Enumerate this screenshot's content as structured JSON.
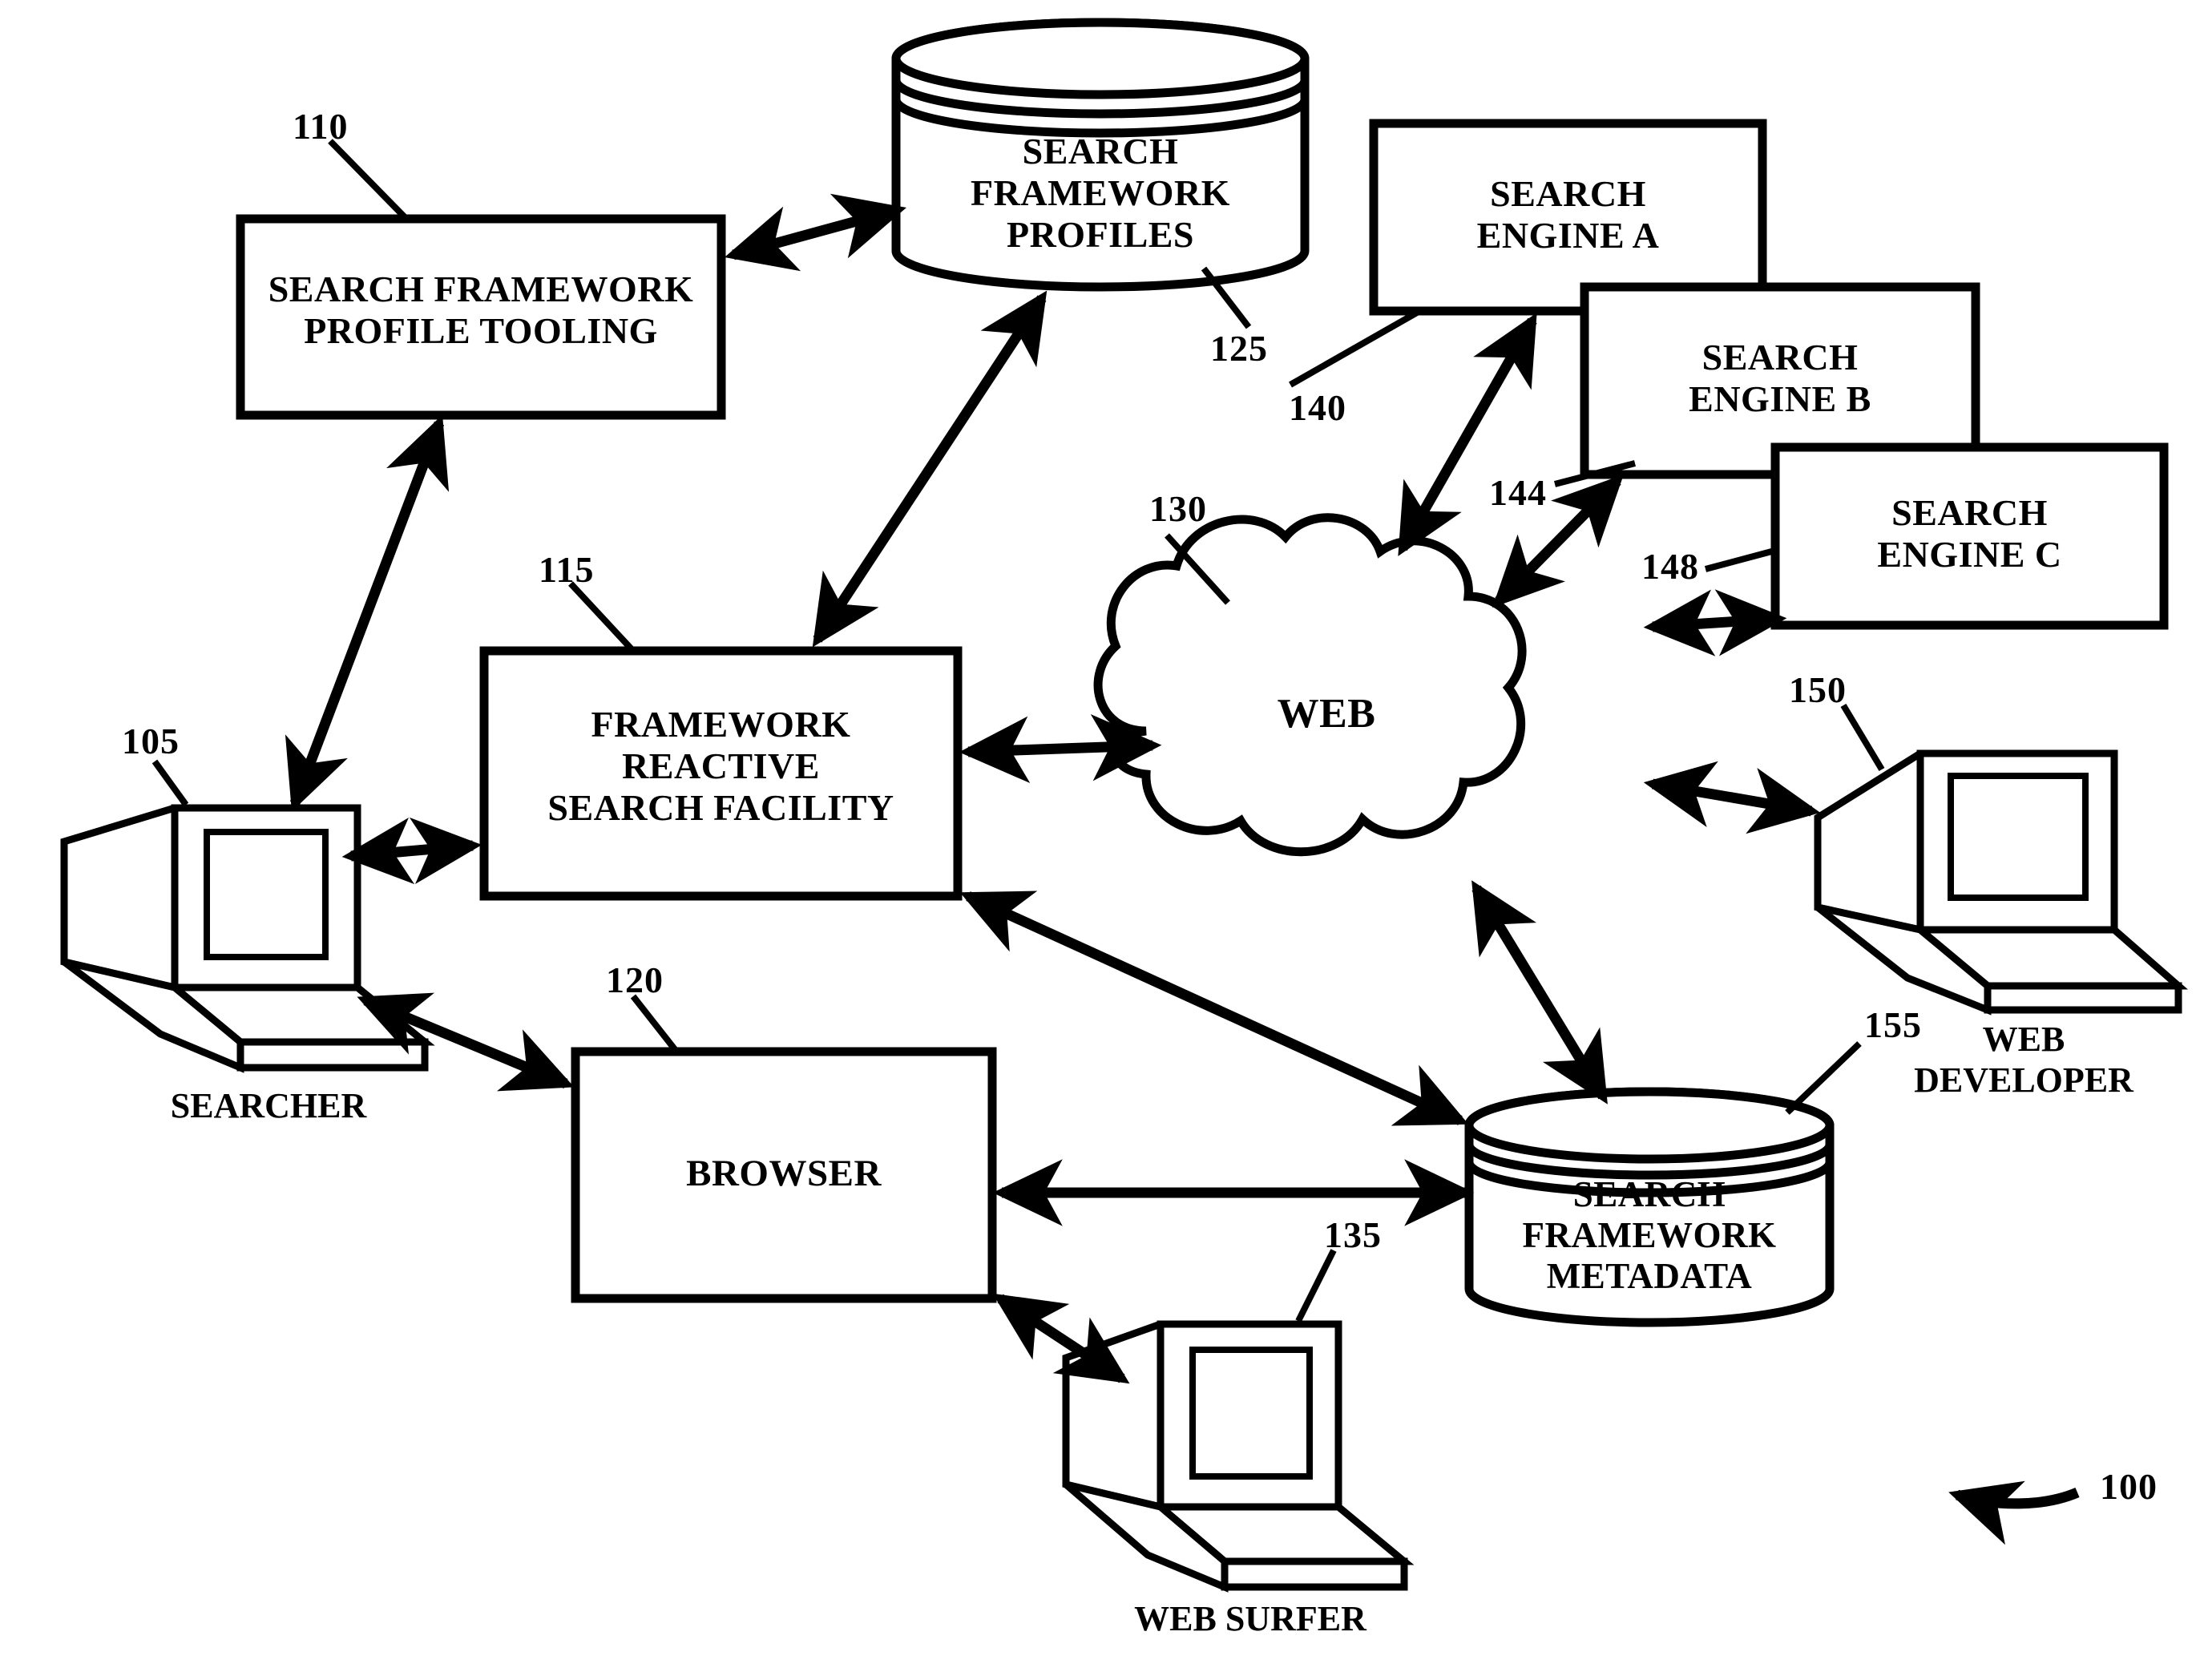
{
  "figure": {
    "reference_numeral": "100",
    "style": {
      "stroke": "#000000",
      "fill": "#ffffff",
      "background": "#ffffff"
    }
  },
  "nodes": {
    "profile_tooling": {
      "label": "SEARCH FRAMEWORK\nPROFILE TOOLING",
      "ref": "110",
      "shape": "rectangle"
    },
    "profiles_store": {
      "label": "SEARCH\nFRAMEWORK\nPROFILES",
      "ref": "125",
      "shape": "cylinder"
    },
    "search_engine_a": {
      "label": "SEARCH\nENGINE A",
      "ref": "140",
      "shape": "rectangle"
    },
    "search_engine_b": {
      "label": "SEARCH\nENGINE B",
      "ref": "144",
      "shape": "rectangle"
    },
    "search_engine_c": {
      "label": "SEARCH\nENGINE C",
      "ref": "148",
      "shape": "rectangle"
    },
    "web_cloud": {
      "label": "WEB",
      "ref": "130",
      "shape": "cloud"
    },
    "search_facility": {
      "label": "FRAMEWORK\nREACTIVE\nSEARCH FACILITY",
      "ref": "115",
      "shape": "rectangle"
    },
    "browser": {
      "label": "BROWSER",
      "ref": "120",
      "shape": "rectangle"
    },
    "metadata_store": {
      "label": "SEARCH\nFRAMEWORK\nMETADATA",
      "ref": "155",
      "shape": "cylinder"
    },
    "searcher_computer": {
      "label": "SEARCHER",
      "ref": "105",
      "shape": "computer"
    },
    "web_surfer_computer": {
      "label": "WEB SURFER",
      "ref": "135",
      "shape": "computer"
    },
    "web_developer_computer": {
      "label": "WEB\nDEVELOPER",
      "ref": "150",
      "shape": "computer"
    }
  },
  "connections": [
    {
      "from": "profile_tooling",
      "to": "profiles_store",
      "arrow": "both"
    },
    {
      "from": "profiles_store",
      "to": "search_facility",
      "arrow": "both"
    },
    {
      "from": "searcher_computer",
      "to": "profile_tooling",
      "arrow": "both"
    },
    {
      "from": "searcher_computer",
      "to": "search_facility",
      "arrow": "both"
    },
    {
      "from": "searcher_computer",
      "to": "browser",
      "arrow": "both"
    },
    {
      "from": "search_facility",
      "to": "web_cloud",
      "arrow": "both"
    },
    {
      "from": "search_facility",
      "to": "metadata_store",
      "arrow": "both"
    },
    {
      "from": "search_engine_a",
      "to": "web_cloud",
      "arrow": "both"
    },
    {
      "from": "search_engine_b",
      "to": "web_cloud",
      "arrow": "both"
    },
    {
      "from": "search_engine_c",
      "to": "web_cloud",
      "arrow": "both"
    },
    {
      "from": "web_developer_computer",
      "to": "web_cloud",
      "arrow": "both"
    },
    {
      "from": "web_cloud",
      "to": "metadata_store",
      "arrow": "both"
    },
    {
      "from": "browser",
      "to": "metadata_store",
      "arrow": "both"
    },
    {
      "from": "browser",
      "to": "web_surfer_computer",
      "arrow": "both"
    }
  ]
}
